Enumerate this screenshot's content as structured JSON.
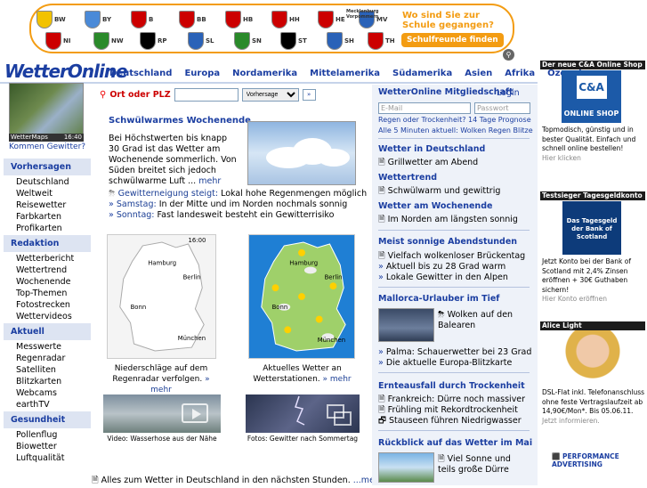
{
  "banner": {
    "states": [
      {
        "abbr": "BW",
        "color": "#f2c200"
      },
      {
        "abbr": "BY",
        "color": "#4a8ad8"
      },
      {
        "abbr": "B",
        "color": "#c00"
      },
      {
        "abbr": "BB",
        "color": "#c00"
      },
      {
        "abbr": "HB",
        "color": "#c00"
      },
      {
        "abbr": "HH",
        "color": "#c00"
      },
      {
        "abbr": "HE",
        "color": "#c00"
      },
      {
        "abbr": "MV",
        "color": "#2a62b8"
      },
      {
        "abbr": "NI",
        "color": "#c00"
      },
      {
        "abbr": "NW",
        "color": "#2a8a2a"
      },
      {
        "abbr": "RP",
        "color": "#000"
      },
      {
        "abbr": "SL",
        "color": "#2a62b8"
      },
      {
        "abbr": "SN",
        "color": "#2a8a2a"
      },
      {
        "abbr": "ST",
        "color": "#000"
      },
      {
        "abbr": "SH",
        "color": "#2a62b8"
      },
      {
        "abbr": "TH",
        "color": "#c00"
      }
    ],
    "mv_label": "Mecklenburg Vorpommern",
    "question": "Wo sind Sie zur Schule gegangen?",
    "button": "Schulfreunde finden",
    "accent": "#f39c12"
  },
  "logo": "WetterOnline",
  "nav": [
    "Deutschland",
    "Europa",
    "Nordamerika",
    "Mittelamerika",
    "Südamerika",
    "Asien",
    "Afrika",
    "Ozeanien"
  ],
  "sidebar": {
    "thumb_label": "WetterMaps",
    "thumb_time": "16:40",
    "kommen": "Kommen Gewitter?",
    "sections": [
      {
        "title": "Vorhersagen",
        "items": [
          "Deutschland",
          "Weltweit",
          "Reisewetter",
          "Farbkarten",
          "Profikarten"
        ]
      },
      {
        "title": "Redaktion",
        "items": [
          "Wetterbericht",
          "Wettertrend",
          "Wochenende",
          "Top-Themen",
          "Fotostrecken",
          "Wettervideos"
        ]
      },
      {
        "title": "Aktuell",
        "items": [
          "Messwerte",
          "Regenradar",
          "Satelliten",
          "Blitzkarten",
          "Webcams",
          "earthTV"
        ]
      },
      {
        "title": "Gesundheit",
        "items": [
          "Pollenflug",
          "Biowetter",
          "Luftqualität"
        ]
      }
    ]
  },
  "search": {
    "label": "Ort oder PLZ",
    "select": "Vorhersage",
    "go": "»"
  },
  "main": {
    "heading": "Schwülwarmes Wochenende",
    "body": "Bei Höchstwerten bis knapp 30 Grad ist das Wetter am Wochenende sommerlich. Von Süden breitet sich jedoch schwülwarme Luft ...",
    "body_more": "mehr",
    "bullet1_link": "Gewitterneigung steigt:",
    "bullet1_text": "Lokal hohe Regenmengen möglich",
    "bullet2_link": "Samstag:",
    "bullet2_text": "In der Mitte und im Norden nochmals sonnig",
    "bullet3_link": "Sonntag:",
    "bullet3_text": "Fast landesweit besteht ein Gewitterrisiko",
    "map1_time": "16:00",
    "map1_cities": [
      "Hamburg",
      "Berlin",
      "Bonn",
      "München"
    ],
    "map2_cities": [
      "Hamburg",
      "Berlin",
      "Bonn",
      "München"
    ],
    "cap1": "Niederschläge auf dem Regenradar verfolgen.",
    "cap2": "Aktuelles Wetter an Wetterstationen.",
    "more": "mehr",
    "vcap1": "Video: Wasserhose aus der Nähe",
    "vcap2": "Fotos: Gewitter nach Sommertag",
    "alles": "Alles zum Wetter in Deutschland in den nächsten Stunden.",
    "alles_more": "...mehr"
  },
  "right": {
    "member_title": "WetterOnline Mitgliedschaft",
    "login": "Login",
    "email_ph": "E-Mail",
    "pw_ph": "Passwort",
    "links1": "Regen oder Trockenheit?   14 Tage Prognose",
    "links2": "Alle 5 Minuten aktuell: Wolken Regen Blitze",
    "wid_title": "Wetter in Deutschland",
    "wid_item": "Grillwetter am Abend",
    "trend_title": "Wettertrend",
    "trend_item": "Schwülwarm und gewittrig",
    "we_title": "Wetter am Wochenende",
    "we_item": "Im Norden am längsten sonnig",
    "sonnig_title": "Meist sonnige Abendstunden",
    "sonnig_items": [
      "Vielfach wolkenloser Brückentag",
      "Aktuell bis zu 28 Grad warm",
      "Lokale Gewitter in den Alpen"
    ],
    "mallorca_title": "Mallorca-Urlauber im Tief",
    "mallorca_item": "Wolken auf den Balearen",
    "mallorca_items": [
      "Palma: Schauerwetter bei 23 Grad",
      "Die aktuelle Europa-Blitzkarte"
    ],
    "ernte_title": "Ernteausfall durch Trockenheit",
    "ernte_items": [
      "Frankreich: Dürre noch massiver",
      "Frühling mit Rekordtrockenheit",
      "Stauseen führen Niedrigwasser"
    ],
    "mai_title": "Rückblick auf das Wetter im Mai",
    "mai_item": "Viel Sonne und teils große Dürre"
  },
  "ads": {
    "ca_head": "Der neue C&A Online Shop",
    "ca_logo": "C&A",
    "ca_sub": "ONLINE SHOP",
    "ca_text": "Topmodisch, günstig und in bester Qualität. Einfach und schnell online bestellen!",
    "ca_link": "Hier klicken",
    "bos_head": "Testsieger Tagesgeldkonto",
    "bos_logo": "Das Tagesgeld der Bank of Scotland",
    "bos_text": "Jetzt Konto bei der Bank of Scotland mit 2,4% Zinsen eröffnen + 30€ Guthaben sichern!",
    "bos_link": "Hier Konto eröffnen",
    "alice_head": "Alice Light",
    "alice_text": "DSL-Flat inkl. Telefonanschluss ohne feste Vertragslaufzeit ab 14,90€/Mon*. Bis 05.06.11.",
    "alice_link": "Jetzt informieren.",
    "perf": "PERFORMANCE ADVERTISING"
  }
}
